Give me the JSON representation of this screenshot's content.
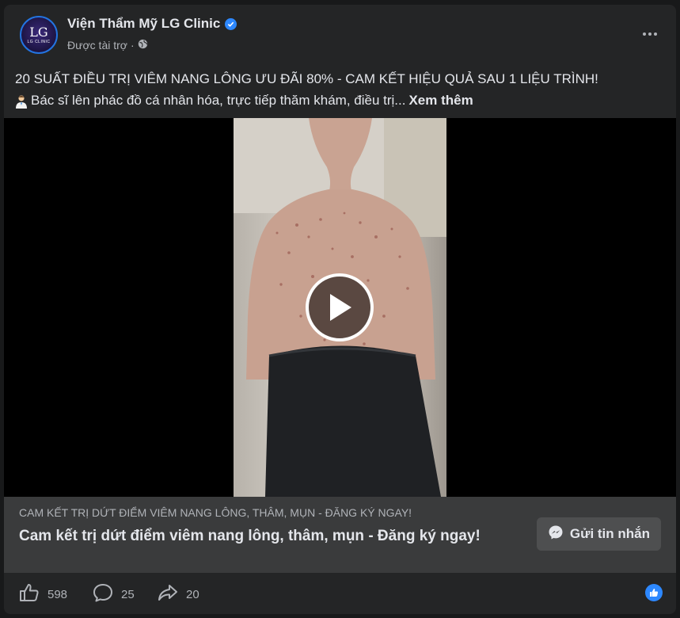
{
  "post": {
    "page_name": "Viện Thẩm Mỹ LG Clinic",
    "sponsored_label": "Được tài trợ",
    "separator": "·",
    "avatar_monogram": "LG",
    "avatar_subtitle": "LG CLINIC",
    "caption_line1": "20 SUẤT ĐIỀU TRỊ VIÊM NANG LÔNG ƯU ĐÃI 80% - CAM KẾT HIỆU QUẢ SAU 1 LIỆU TRÌNH!",
    "caption_line2": "Bác sĩ lên phác đồ cá nhân hóa, trực tiếp thăm khám, điều trị...",
    "see_more": "Xem thêm"
  },
  "cta": {
    "domain_text": "CAM KẾT TRỊ DỨT ĐIỂM VIÊM NANG LÔNG, THÂM, MỤN - ĐĂNG KÝ NGAY!",
    "headline": "Cam kết trị dứt điểm viêm nang lông, thâm, mụn - Đăng ký ngay!",
    "button_label": "Gửi tin nhắn"
  },
  "stats": {
    "likes": "598",
    "comments": "25",
    "shares": "20"
  },
  "icons": {
    "verified": "verified-badge-icon",
    "globe": "globe-icon",
    "more": "more-options-icon",
    "play": "play-icon",
    "messenger": "messenger-icon",
    "like": "like-icon",
    "comment": "comment-icon",
    "share": "share-icon"
  },
  "colors": {
    "accent": "#2d88ff",
    "card_bg": "#242526",
    "cta_bg": "#3a3b3c"
  }
}
